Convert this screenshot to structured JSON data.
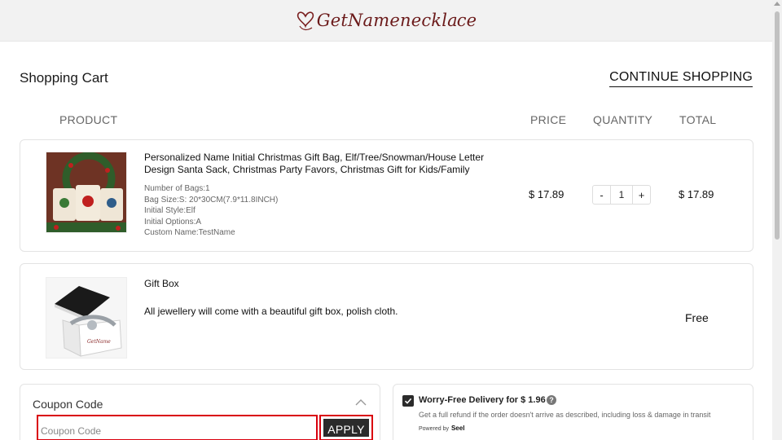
{
  "header": {
    "logo_text": "GetNameneckl ace"
  },
  "cart": {
    "title": "Shopping Cart",
    "continue_label": "CONTINUE SHOPPING",
    "columns": {
      "product": "PRODUCT",
      "price": "PRICE",
      "quantity": "QUANTITY",
      "total": "TOTAL"
    },
    "items": [
      {
        "name": "Personalized Name Initial Christmas Gift Bag, Elf/Tree/Snowman/House Letter Design Santa Sack, Christmas Party Favors, Christmas Gift for Kids/Family",
        "options": [
          "Number of Bags:1",
          "Bag Size:S: 20*30CM(7.9*11.8INCH)",
          "Initial Style:Elf",
          "Initial Options:A",
          "Custom Name:TestName"
        ],
        "price": "$ 17.89",
        "quantity": "1",
        "qty_minus": "-",
        "qty_plus": "+",
        "total": "$ 17.89"
      },
      {
        "name": "Gift Box",
        "description": "All jewellery will come with a beautiful gift box, polish cloth.",
        "total": "Free"
      }
    ]
  },
  "coupon": {
    "label": "Coupon Code",
    "placeholder": "Coupon Code",
    "apply_label": "APPLY"
  },
  "delivery": {
    "title": "Worry-Free Delivery for $ 1.96",
    "help": "?",
    "description": "Get a full refund if the order doesn't arrive as described, including loss & damage in transit",
    "powered_by": "Powered by",
    "brand": "Seel",
    "checked": true
  },
  "colors": {
    "accent_dark": "#2b2b2b",
    "highlight_red": "#d9000d",
    "logo_brown": "#6b1a1a"
  },
  "icons": [
    "heart-logo-icon",
    "chevron-up-icon",
    "checkmark-icon",
    "question-icon"
  ]
}
